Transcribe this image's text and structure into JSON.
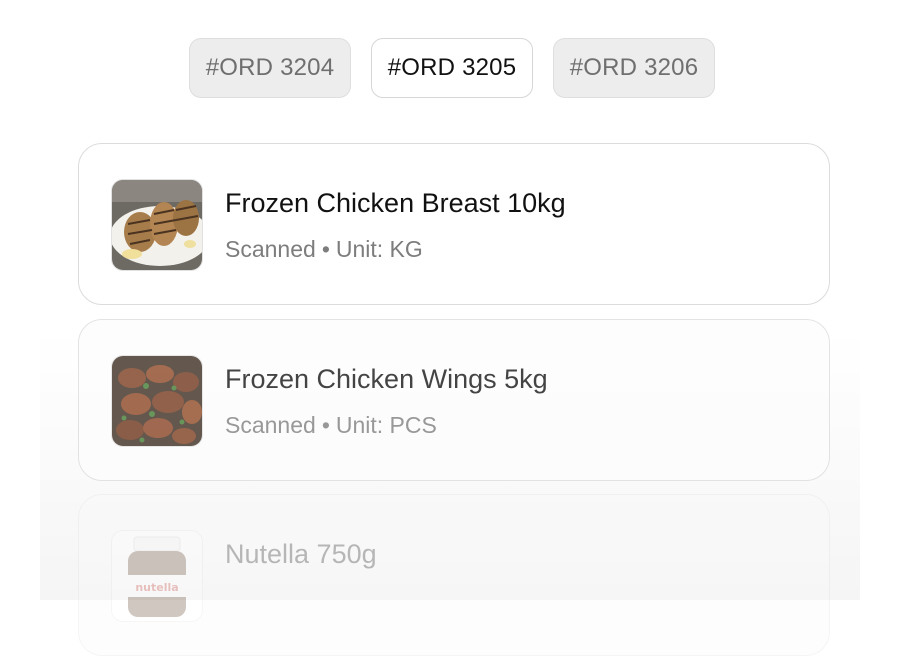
{
  "order_tabs": [
    {
      "label": "#ORD 3204",
      "active": false
    },
    {
      "label": "#ORD 3205",
      "active": true
    },
    {
      "label": "#ORD 3206",
      "active": false
    }
  ],
  "items": [
    {
      "name": "Frozen Chicken Breast 10kg",
      "status": "Scanned",
      "separator": "•",
      "unit": "Unit: KG",
      "thumbnail": "chicken-breast-image"
    },
    {
      "name": "Frozen Chicken Wings 5kg",
      "status": "Scanned",
      "separator": "•",
      "unit": "Unit: PCS",
      "thumbnail": "chicken-wings-image"
    },
    {
      "name": "Nutella 750g",
      "thumbnail": "nutella-jar-image",
      "thumbnail_text": "nutella"
    }
  ]
}
